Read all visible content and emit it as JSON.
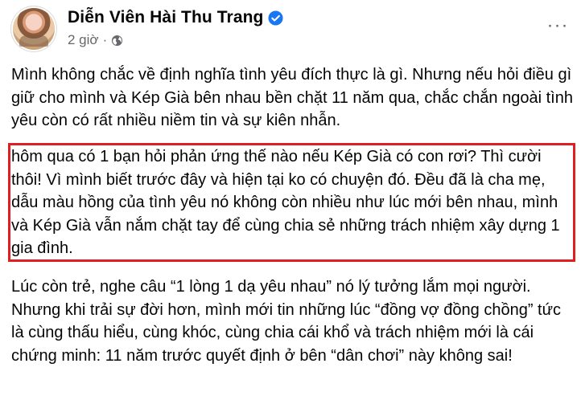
{
  "post": {
    "author_name": "Diễn Viên Hài Thu Trang",
    "timestamp": "2 giờ",
    "separator": "·",
    "more_options": "···",
    "paragraph_1": "Mình không chắc về định nghĩa tình yêu đích thực là gì. Nhưng nếu hỏi điều gì giữ cho mình và Kép Già bên nhau bền chặt 11 năm qua, chắc chắn ngoài tình yêu còn có rất nhiều niềm tin và sự kiên nhẫn.",
    "paragraph_2": "hôm qua có 1 bạn hỏi phản ứng thế nào nếu Kép Già có con rơi? Thì cười thôi! Vì mình biết trước đây và hiện tại ko có chuyện đó. Đều đã là cha mẹ, dẫu màu hồng của tình yêu nó không còn nhiều như lúc mới bên nhau, mình và Kép Già vẫn nắm chặt tay để cùng chia sẻ những trách nhiệm xây dựng 1 gia đình.",
    "paragraph_3": "Lúc còn trẻ, nghe câu “1 lòng 1 dạ yêu nhau” nó lý tưởng lắm mọi người. Nhưng khi trải sự đời hơn, mình mới tin những lúc “đồng vợ đồng chồng” tức là cùng thấu hiểu, cùng khóc, cùng chia cái khổ và trách nhiệm mới là cái chứng minh: 11 năm trước quyết định ở bên “dân chơi” này không sai!"
  },
  "icons": {
    "verified": "verified-badge-icon",
    "audience": "globe-icon",
    "more": "more-options-icon"
  },
  "colors": {
    "verified_blue": "#1877f2",
    "meta_gray": "#65676b",
    "highlight_red": "#e02020",
    "text": "#050505"
  }
}
